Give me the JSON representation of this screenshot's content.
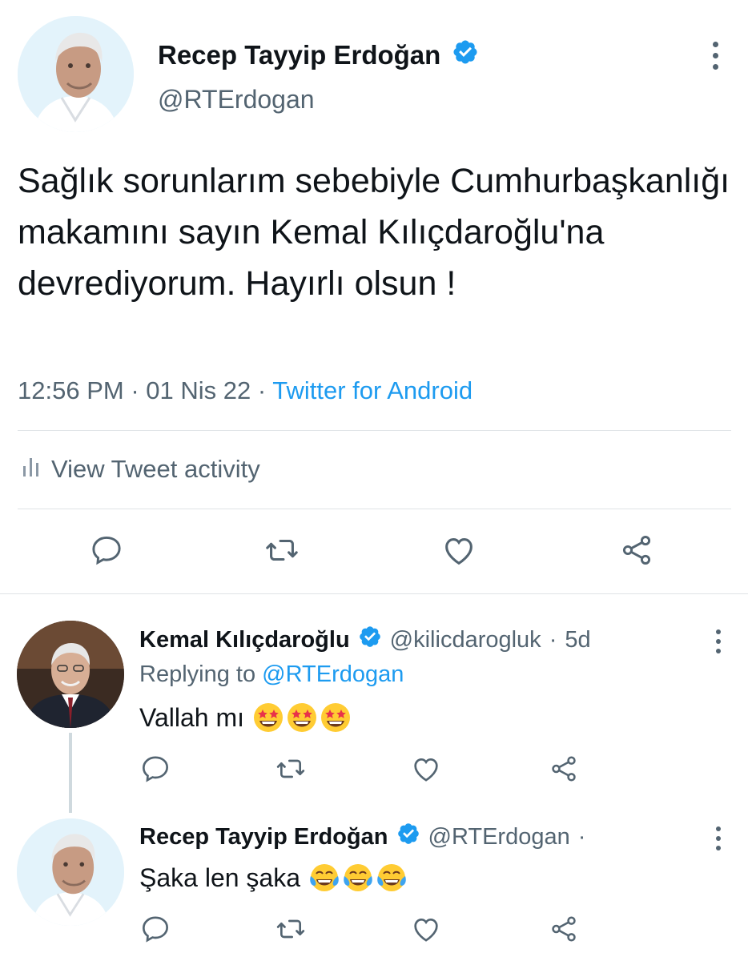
{
  "main_tweet": {
    "author_name": "Recep Tayyip Erdoğan",
    "author_handle": "@RTErdogan",
    "text": "Sağlık sorunlarım sebebiyle Cumhurbaşkanlığı makamını sayın Kemal Kılıçdaroğlu'na devrediyorum. Hayırlı olsun !",
    "time": "12:56 PM",
    "date": "01 Nis 22",
    "client": "Twitter for Android",
    "activity_label": "View Tweet activity",
    "icons": [
      "reply-icon",
      "retweet-icon",
      "like-icon",
      "share-icon"
    ]
  },
  "replies": [
    {
      "author_name": "Kemal Kılıçdaroğlu",
      "author_handle": "@kilicdarogluk",
      "age": "5d",
      "replying_prefix": "Replying to",
      "replying_to": "@RTErdogan",
      "text": "Vallah mı",
      "emoji": "star-struck",
      "emoji_count": 3
    },
    {
      "author_name": "Recep Tayyip Erdoğan",
      "author_handle": "@RTErdogan",
      "text": "Şaka len şaka",
      "emoji": "tears-of-joy",
      "emoji_count": 3
    }
  ],
  "colors": {
    "text": "#0f1419",
    "secondary": "#536471",
    "accent": "#1d9bf0",
    "divider": "#dfe3e6"
  }
}
